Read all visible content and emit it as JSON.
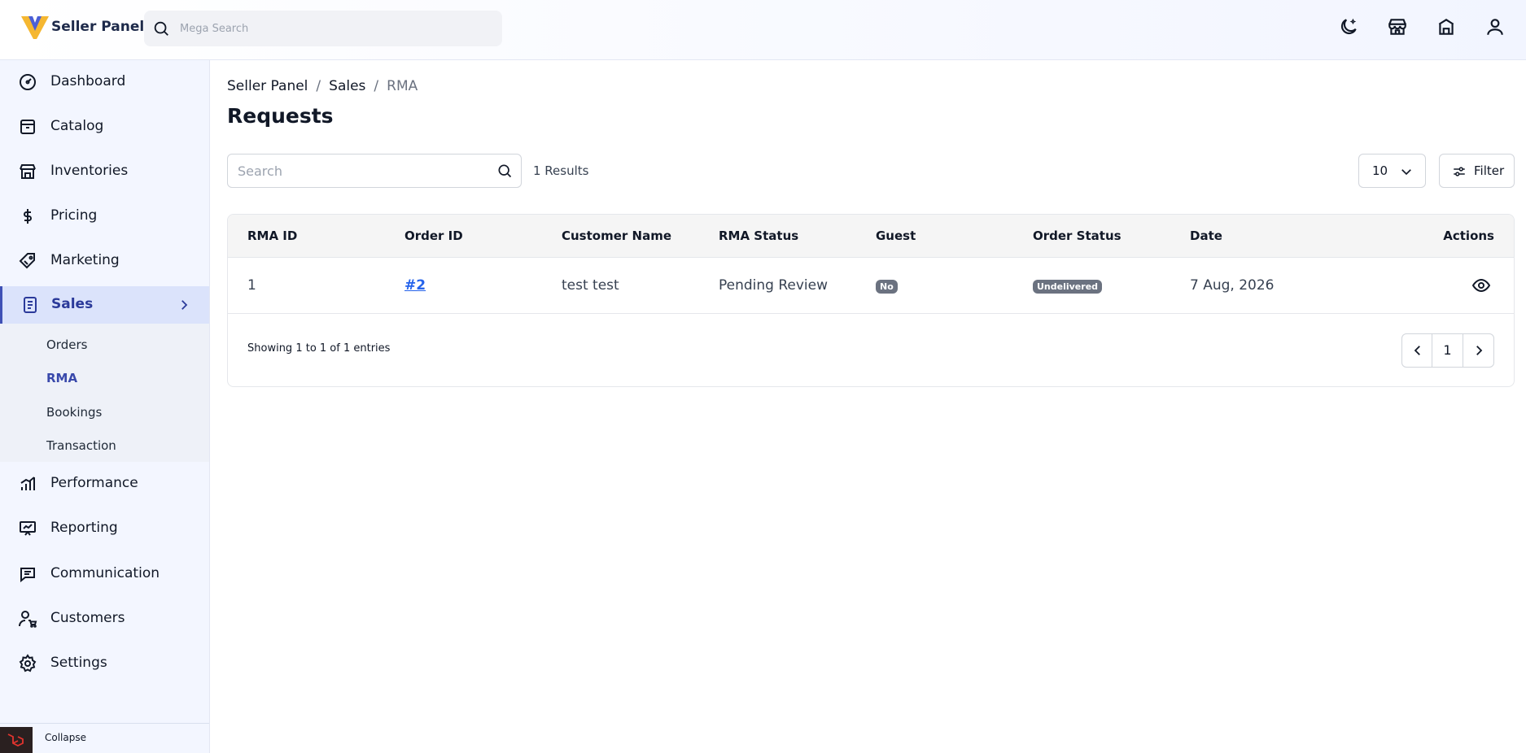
{
  "header": {
    "brand": "Seller Panel",
    "search_placeholder": "Mega Search",
    "icons": [
      "theme-toggle-icon",
      "storefront-icon",
      "shop-icon",
      "user-icon"
    ]
  },
  "sidebar": {
    "items": [
      {
        "label": "Dashboard",
        "icon": "dashboard-icon"
      },
      {
        "label": "Catalog",
        "icon": "catalog-icon"
      },
      {
        "label": "Inventories",
        "icon": "inventory-icon"
      },
      {
        "label": "Pricing",
        "icon": "dollar-icon"
      },
      {
        "label": "Marketing",
        "icon": "tag-icon"
      },
      {
        "label": "Sales",
        "icon": "document-icon"
      },
      {
        "label": "Performance",
        "icon": "bar-chart-icon"
      },
      {
        "label": "Reporting",
        "icon": "presentation-icon"
      },
      {
        "label": "Communication",
        "icon": "message-icon"
      },
      {
        "label": "Customers",
        "icon": "customers-icon"
      },
      {
        "label": "Settings",
        "icon": "gear-icon"
      }
    ],
    "sales_submenu": [
      "Orders",
      "RMA",
      "Bookings",
      "Transaction"
    ],
    "collapse_label": "Collapse"
  },
  "breadcrumb": {
    "root": "Seller Panel",
    "parent": "Sales",
    "current": "RMA"
  },
  "page_title": "Requests",
  "toolbar": {
    "search_placeholder": "Search",
    "results": "1 Results",
    "per_page": "10",
    "filter_label": "Filter"
  },
  "table": {
    "columns": [
      "RMA ID",
      "Order ID",
      "Customer Name",
      "RMA Status",
      "Guest",
      "Order Status",
      "Date",
      "Actions"
    ],
    "rows": [
      {
        "rma_id": "1",
        "order_id": "#2",
        "customer": "test test",
        "rma_status": "Pending Review",
        "guest": "No",
        "order_status": "Undelivered",
        "date": "7 Aug, 2026"
      }
    ],
    "showing": "Showing 1 to 1 of 1 entries",
    "page": "1"
  },
  "colors": {
    "accent": "#3f51b5",
    "active_bg": "#dbe3fb",
    "badge": "#6b7280",
    "link": "#2563eb"
  }
}
